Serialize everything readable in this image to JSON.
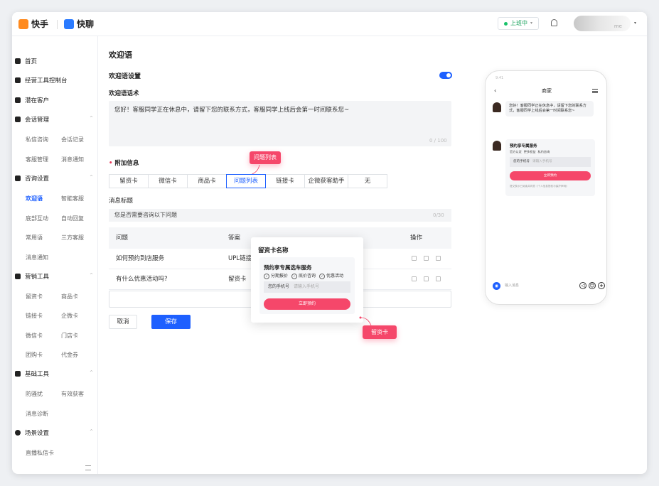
{
  "topbar": {
    "app1": "快手",
    "app2": "快聊",
    "status": "上班中",
    "status_caret": "▾",
    "user_suffix": "me",
    "caret": "▾"
  },
  "sidebar": {
    "home": "首页",
    "console": "经营工具控制台",
    "potential": "潜在客户",
    "session_mgmt": "会话管理",
    "session_items": [
      "私信咨询",
      "会话记录",
      "客服管理",
      "消息通知"
    ],
    "consult": "咨询设置",
    "consult_items": [
      "欢迎语",
      "智能客服",
      "底部互动",
      "自动回复",
      "常用语",
      "三方客服",
      "消息通知"
    ],
    "marketing": "营销工具",
    "marketing_items": [
      "留资卡",
      "商品卡",
      "链接卡",
      "企微卡",
      "微信卡",
      "门店卡",
      "团购卡",
      "代金券"
    ],
    "basic": "基础工具",
    "basic_items": [
      "防骚扰",
      "有效获客",
      "消息诊断"
    ],
    "scene": "场景设置",
    "scene_items": [
      "直播私信卡"
    ],
    "chevron": "^"
  },
  "page": {
    "title": "欢迎语",
    "welcome_setting": "欢迎语设置",
    "script_label": "欢迎语话术",
    "script_text": "您好！客服同学正在休息中，请留下您的联系方式，客服同学上线后会第一时间联系您~",
    "script_count": "0 / 100",
    "attach_req": "•",
    "attach_label": "附加信息",
    "tabs": [
      "留资卡",
      "微信卡",
      "商品卡",
      "问题列表",
      "链接卡",
      "企微获客助手",
      "无"
    ],
    "msg_title_label": "消息标题",
    "msg_title_value": "您是否需要咨询以下问题",
    "msg_title_count": "0/30",
    "table_headers": [
      "问题",
      "答案",
      "操作"
    ],
    "rows": [
      {
        "q": "如何预约到店服务",
        "a": "UPL链接"
      },
      {
        "q": "有什么优惠活动吗?",
        "a": "留资卡"
      }
    ],
    "cancel": "取消",
    "save": "保存"
  },
  "callouts": {
    "top": "问题列表",
    "bottom": "留资卡"
  },
  "popup": {
    "title": "留资卡名称",
    "card_title": "预约享专属选车服务",
    "options": [
      "分期报价",
      "底价咨询",
      "优惠活动"
    ],
    "input_label": "您的手机号",
    "input_placeholder": "请输入手机号",
    "button": "立即预约"
  },
  "phone": {
    "status": "9:41",
    "title": "商家",
    "back": "‹",
    "bubble": "您好！客服同学正在休息中，请留下您的联系方式，客服同学上线后会第一时间联系您~",
    "card_title": "预约享专属服务",
    "card_options": [
      "官方认证",
      "更多权益",
      "私约咨询"
    ],
    "input_label": "您的手机号",
    "input_placeholder": "请输入手机号",
    "button": "立即预约",
    "agreement": "提交表示已阅读并同意《个人信息授权与保护声明》",
    "chat_placeholder": "输入消息",
    "cam": "◉",
    "i1": "◁",
    "i2": "☺",
    "i3": "+"
  },
  "colors": {
    "accent": "#1e60ff",
    "brand_pink": "#f5476a",
    "online": "#19c26a"
  }
}
